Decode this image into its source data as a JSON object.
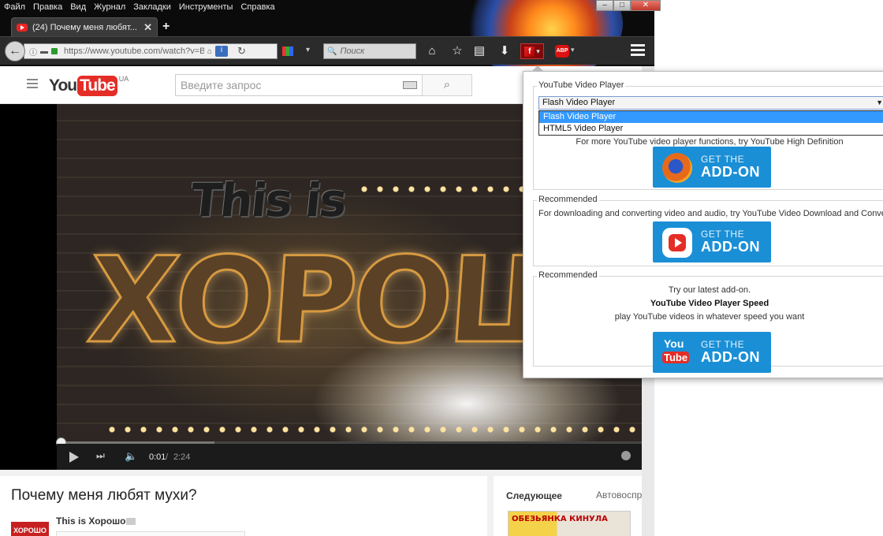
{
  "browser": {
    "menu": [
      "Файл",
      "Правка",
      "Вид",
      "Журнал",
      "Закладки",
      "Инструменты",
      "Справка"
    ],
    "tab": {
      "title": "(24) Почему меня любят...",
      "close": "✕"
    },
    "new_tab": "+",
    "url": "https://www.youtube.com/watch?v=B/",
    "search_placeholder": "Поиск",
    "window_controls": {
      "minimize": "–",
      "maximize": "□",
      "close": "✕"
    }
  },
  "youtube": {
    "logo_you": "You",
    "logo_tube": "Tube",
    "region": "UA",
    "search_placeholder": "Введите запрос",
    "video": {
      "overlay_top": "This is",
      "overlay_main": "ХОРОШО",
      "time_current": "0:01",
      "time_separator": "/",
      "time_total": "2:24",
      "progress_played": 0.007,
      "progress_buffered": 0.27
    },
    "title": "Почему меня любят мухи?",
    "channel": {
      "name": "This is Хорошо",
      "thumb_text": "ХОРОШО"
    },
    "sidebar": {
      "next_label": "Следующее",
      "autoplay_label": "Автовоспроизведение",
      "next_thumb_text": "ОБЕЗЬЯНКА КИНУЛА"
    }
  },
  "popup": {
    "section1": {
      "legend": "YouTube Video Player",
      "selected": "Flash Video Player",
      "options": [
        "Flash Video Player",
        "HTML5 Video Player"
      ],
      "description": "For more YouTube video player functions, try YouTube High Definition"
    },
    "section2": {
      "legend": "Recommended",
      "description": "For downloading and converting video and audio, try YouTube Video Download and Converter"
    },
    "section3": {
      "legend": "Recommended",
      "line1": "Try our latest add-on.",
      "line2": "YouTube Video Player Speed",
      "line3": "play YouTube videos in whatever speed you want"
    },
    "button": {
      "get_the": "GET THE",
      "add_on": "ADD-ON"
    }
  }
}
